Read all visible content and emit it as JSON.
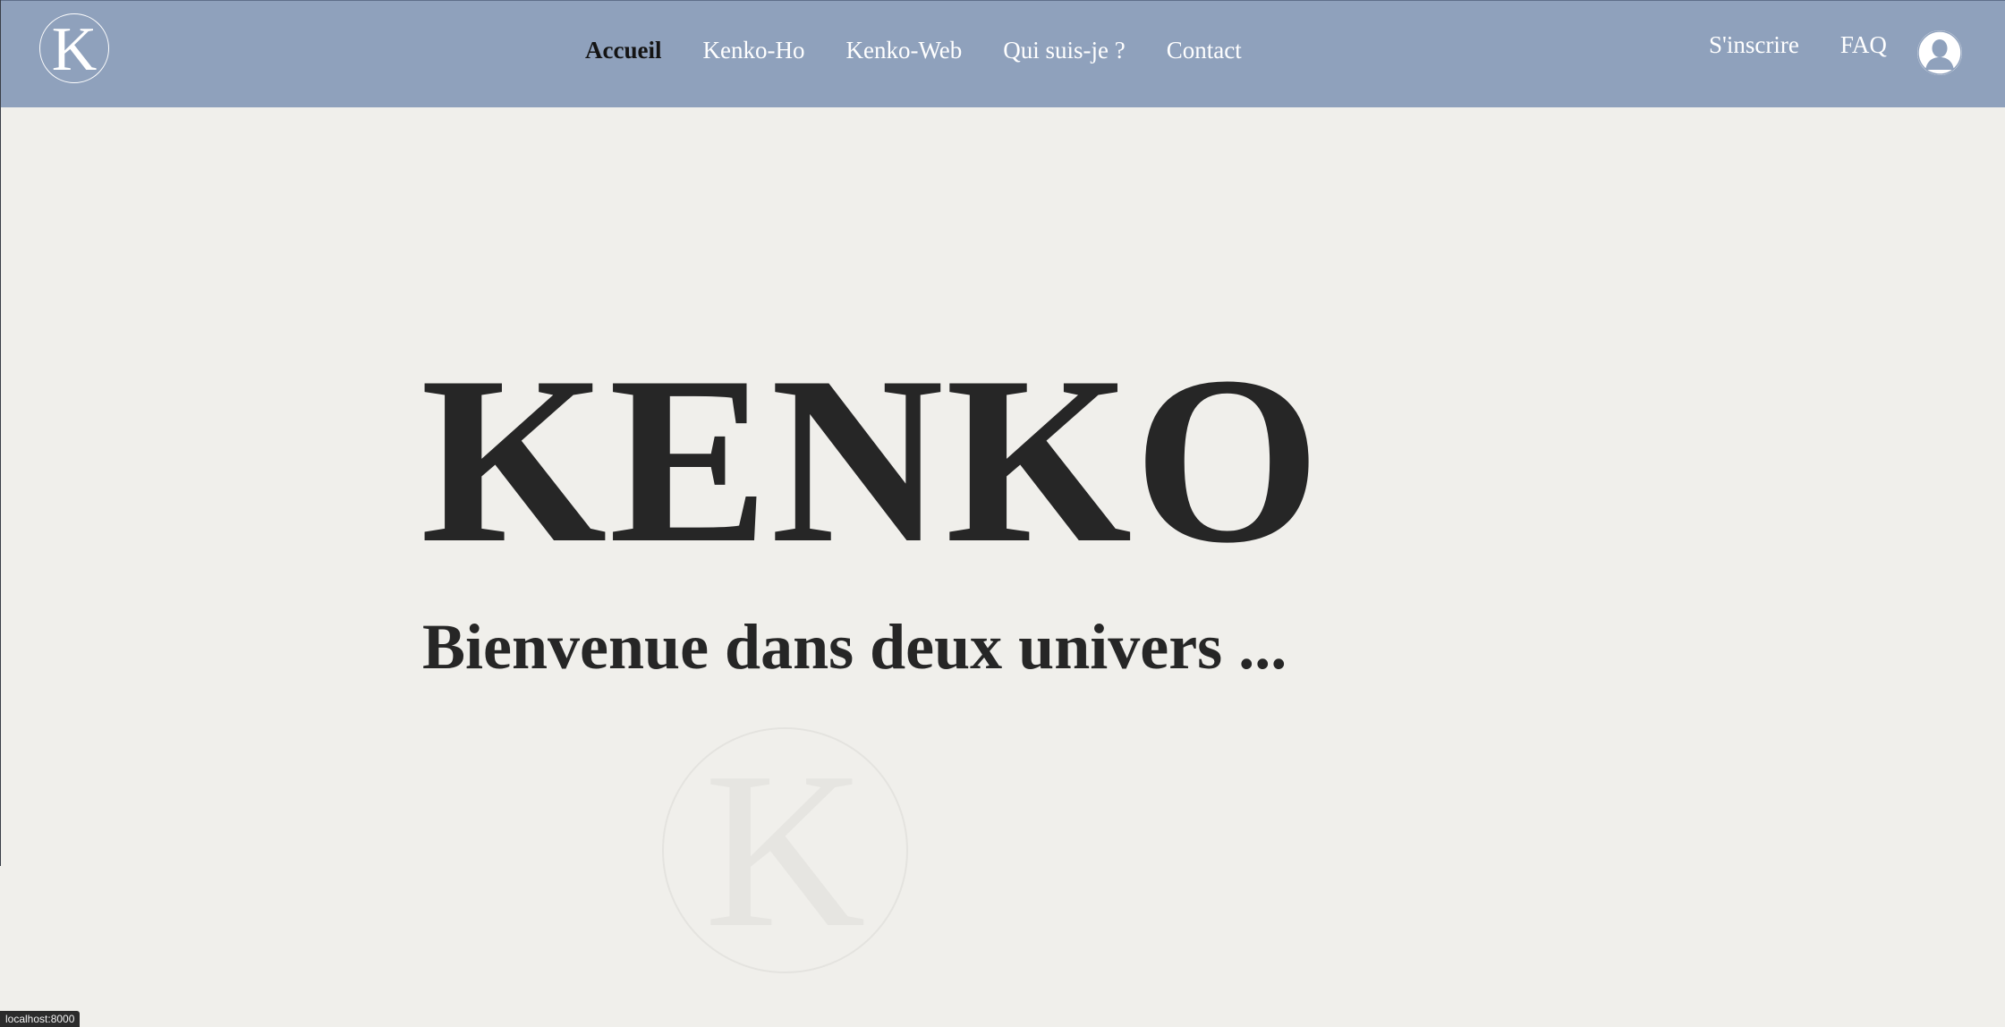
{
  "header": {
    "logo_letter": "K",
    "nav": [
      {
        "label": "Accueil",
        "active": true
      },
      {
        "label": "Kenko-Ho",
        "active": false
      },
      {
        "label": "Kenko-Web",
        "active": false
      },
      {
        "label": "Qui suis-je ?",
        "active": false
      },
      {
        "label": "Contact",
        "active": false
      }
    ],
    "right": {
      "signup_label": "S'inscrire",
      "faq_label": "FAQ",
      "avatar_icon": "user-avatar-icon"
    }
  },
  "hero": {
    "title": "KENKO",
    "subtitle": "Bienvenue dans deux univers ...",
    "watermark_letter": "K"
  },
  "status_bar": {
    "url": "localhost:8000"
  },
  "colors": {
    "header_bg": "#8fa1bc",
    "page_bg": "#f0efeb",
    "text_dark": "#262626",
    "nav_text": "#ffffff"
  }
}
